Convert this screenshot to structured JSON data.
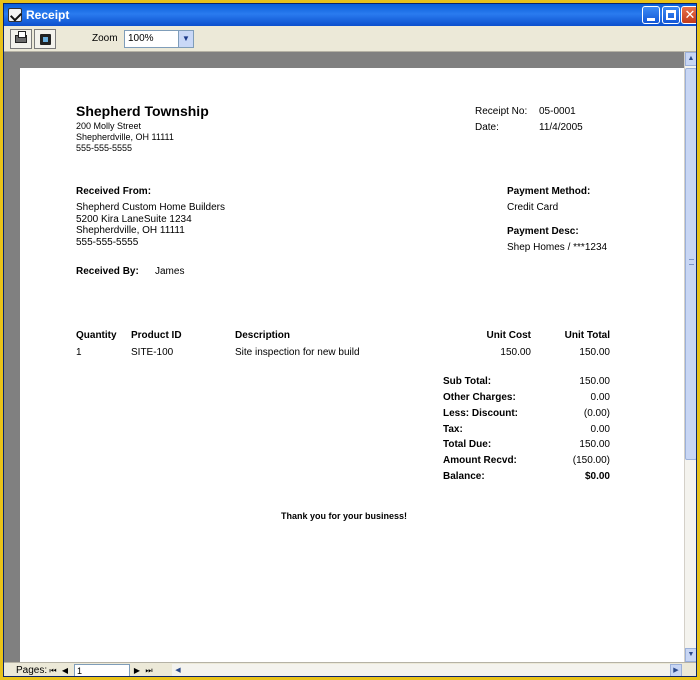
{
  "window": {
    "title": "Receipt",
    "icon": "receipt-app-icon",
    "controls": {
      "minimize": "minimize-icon",
      "maximize": "maximize-icon",
      "close": "close-icon"
    }
  },
  "toolbar": {
    "print_icon": "printer-icon",
    "export_icon": "export-icon",
    "zoom_label": "Zoom",
    "zoom_value": "100%"
  },
  "receipt": {
    "company": {
      "name": "Shepherd Township",
      "address1": "200 Molly Street",
      "address2": "Shepherdville,  OH  11111",
      "phone": "555-555-5555"
    },
    "meta": {
      "receipt_no_label": "Receipt No:",
      "receipt_no": "05-0001",
      "date_label": "Date:",
      "date": "11/4/2005"
    },
    "received_from": {
      "label": "Received From:",
      "line1": "Shepherd Custom Home Builders",
      "line2": "5200 Kira LaneSuite 1234",
      "line3": "Shepherdville, OH  11111",
      "line4": "555-555-5555"
    },
    "payment": {
      "method_label": "Payment Method:",
      "method": "Credit Card",
      "desc_label": "Payment Desc:",
      "desc": "Shep Homes / ***1234"
    },
    "received_by": {
      "label": "Received By:",
      "value": "James"
    },
    "table": {
      "headers": [
        "Quantity",
        "Product ID",
        "Description",
        "Unit Cost",
        "Unit Total"
      ],
      "rows": [
        [
          "1",
          "SITE-100",
          "Site inspection for new build",
          "150.00",
          "150.00"
        ]
      ]
    },
    "totals": [
      {
        "label": "Sub Total:",
        "value": "150.00"
      },
      {
        "label": "Other Charges:",
        "value": "0.00"
      },
      {
        "label": "Less:  Discount:",
        "value": "(0.00)"
      },
      {
        "label": "Tax:",
        "value": "0.00"
      },
      {
        "label": "Total Due:",
        "value": "150.00"
      },
      {
        "label": "Amount Recvd:",
        "value": "(150.00)"
      },
      {
        "label": "Balance:",
        "value": "$0.00"
      }
    ],
    "footer": "Thank you for your business!"
  },
  "statusbar": {
    "pages_label": "Pages:",
    "page_value": "1"
  }
}
